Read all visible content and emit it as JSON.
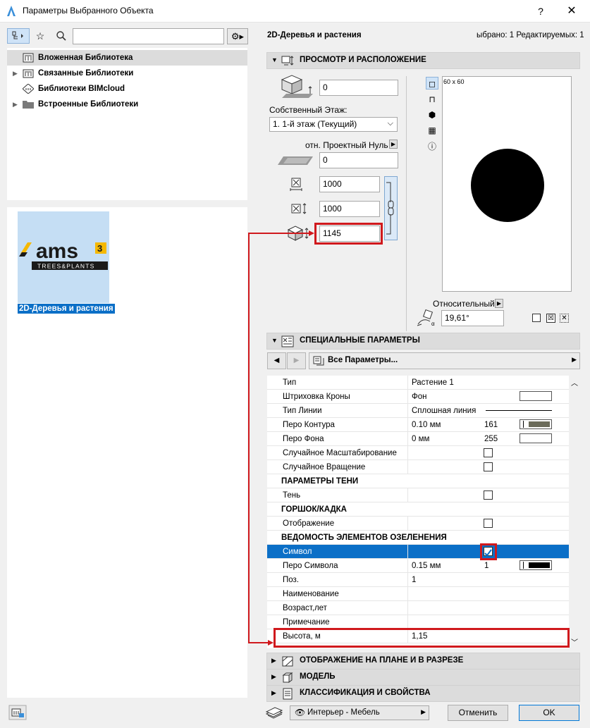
{
  "window": {
    "title": "Параметры Выбранного Объекта",
    "help": "?",
    "close": "✕"
  },
  "left": {
    "search": {
      "value": "",
      "placeholder": ""
    },
    "tree": [
      {
        "label": "Вложенная Библиотека"
      },
      {
        "label": "Связанные Библиотеки"
      },
      {
        "label": "Библиотеки BIMcloud"
      },
      {
        "label": "Встроенные Библиотеки"
      }
    ],
    "thumb": {
      "logo_main": "ams",
      "logo_sup": "3",
      "logo_sub": "TREES&PLANTS",
      "label": "2D-Деревья и растения"
    }
  },
  "header": {
    "object_name": "2D-Деревья и растения",
    "status": "ыбрано: 1 Редактируемых: 1"
  },
  "sections": {
    "view": "ПРОСМОТР И РАСПОЛОЖЕНИЕ",
    "special": "СПЕЦИАЛЬНЫЕ ПАРАМЕТРЫ",
    "plan": "ОТОБРАЖЕНИЕ НА ПЛАНЕ И В РАЗРЕЗЕ",
    "model": "МОДЕЛЬ",
    "classification": "КЛАССИФИКАЦИЯ И СВОЙСТВА"
  },
  "placement": {
    "offset": "0",
    "home_story_label": "Собственный Этаж:",
    "home_story_value": "1. 1-й этаж (Текущий)",
    "ref_label": "отн. Проектный Нуль",
    "ref_value": "0",
    "width": "1000",
    "depth": "1000",
    "height": "1145",
    "preview_size": "60 x 60",
    "relative_label": "Относительный",
    "angle": "19,61°"
  },
  "params": {
    "filter": "Все Параметры...",
    "rows": [
      {
        "name": "Тип",
        "value": "Растение 1",
        "extra": "",
        "type": "text"
      },
      {
        "name": "Штриховка Кроны",
        "value": "Фон",
        "extra": "",
        "type": "swatch"
      },
      {
        "name": "Тип Линии",
        "value": "Сплошная линия",
        "extra": "",
        "type": "line"
      },
      {
        "name": "Перо Контура",
        "value": "0.10 мм",
        "extra": "161",
        "type": "pen"
      },
      {
        "name": "Перо Фона",
        "value": "0 мм",
        "extra": "255",
        "type": "swatch"
      },
      {
        "name": "Случайное Масштабирование",
        "value": "",
        "extra": "",
        "type": "check"
      },
      {
        "name": "Случайное Вращение",
        "value": "",
        "extra": "",
        "type": "check"
      },
      {
        "name": "ПАРАМЕТРЫ ТЕНИ",
        "value": "",
        "extra": "",
        "type": "group"
      },
      {
        "name": "Тень",
        "value": "",
        "extra": "",
        "type": "check"
      },
      {
        "name": "ГОРШОК/КАДКА",
        "value": "",
        "extra": "",
        "type": "group"
      },
      {
        "name": "Отображение",
        "value": "",
        "extra": "",
        "type": "check"
      },
      {
        "name": "ВЕДОМОСТЬ ЭЛЕМЕНТОВ ОЗЕЛЕНЕНИЯ",
        "value": "",
        "extra": "",
        "type": "group"
      },
      {
        "name": "Символ",
        "value": "",
        "extra": "",
        "type": "check-on"
      },
      {
        "name": "Перо Символа",
        "value": "0.15 мм",
        "extra": "1",
        "type": "pen-black"
      },
      {
        "name": "Поз.",
        "value": "1",
        "extra": "",
        "type": "text"
      },
      {
        "name": "Наименование",
        "value": "",
        "extra": "",
        "type": "text"
      },
      {
        "name": "Возраст,лет",
        "value": "",
        "extra": "",
        "type": "text"
      },
      {
        "name": "Примечание",
        "value": "",
        "extra": "",
        "type": "text"
      },
      {
        "name": "Высота, м",
        "value": "1,15",
        "extra": "",
        "type": "text"
      }
    ]
  },
  "footer": {
    "favorites": "Интерьер - Мебель",
    "cancel": "Отменить",
    "ok": "OK"
  },
  "colors": {
    "accent": "#0b6fc7",
    "highlight": "#d0191d",
    "thumb_bg": "#c5def4",
    "logo_yellow": "#f5b800"
  }
}
